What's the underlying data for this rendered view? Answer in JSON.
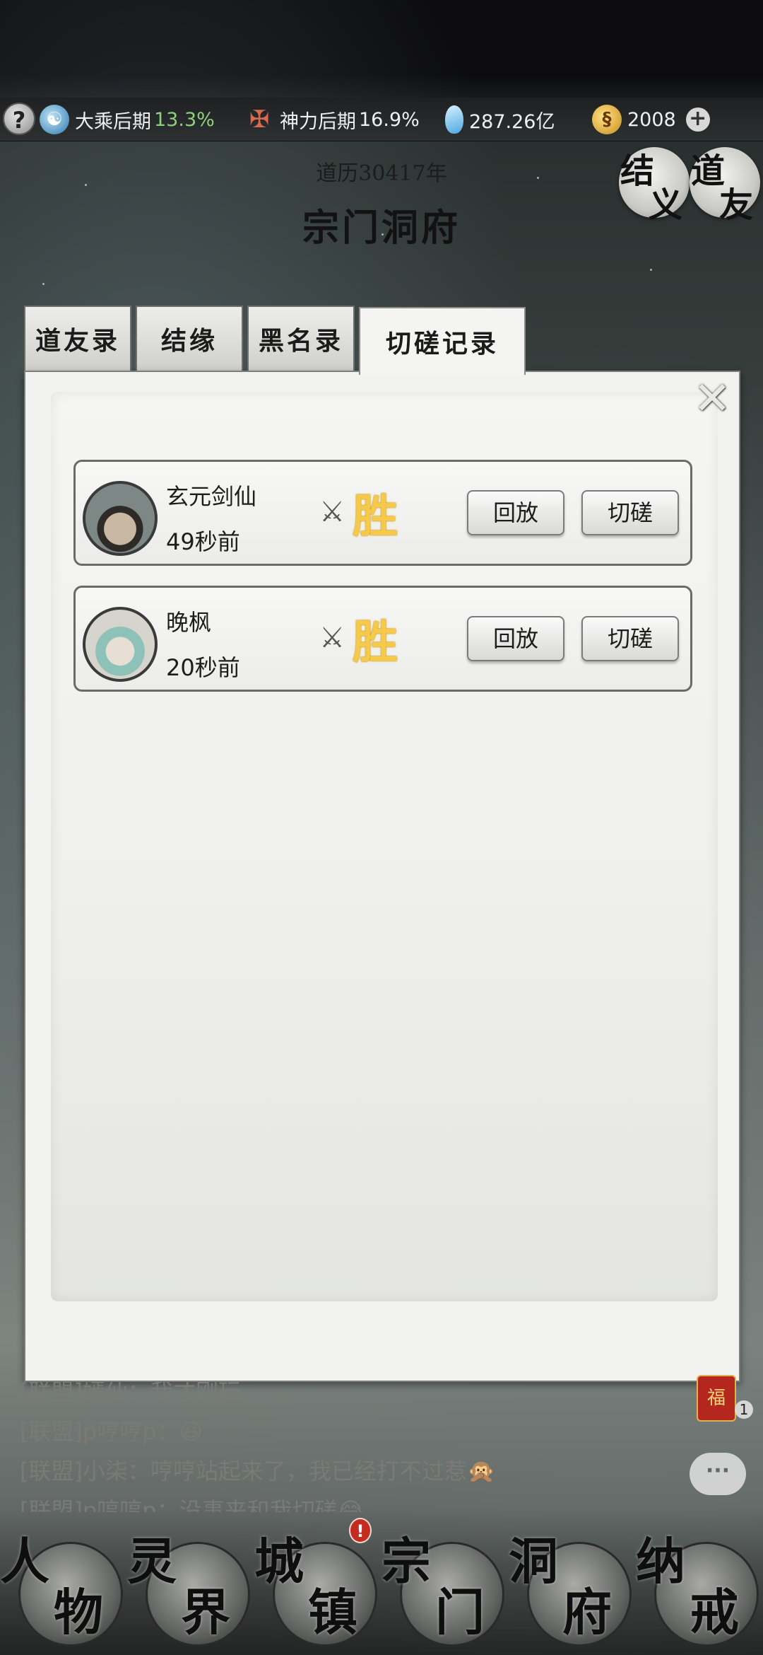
{
  "resources": {
    "cultivation_label": "大乘后期",
    "cultivation_pct": "13.3%",
    "divine_label": "神力后期",
    "divine_pct": "16.9%",
    "crystals": "287.26亿",
    "coins": "2008"
  },
  "header": {
    "year": "道历30417年",
    "title": "宗门洞府"
  },
  "top_buttons": [
    {
      "c1": "结",
      "c2": "义"
    },
    {
      "c1": "道",
      "c2": "友"
    }
  ],
  "tabs": [
    "道友录",
    "结缘",
    "黑名录",
    "切磋记录"
  ],
  "active_tab": "切磋记录",
  "records": [
    {
      "name": "玄元剑仙",
      "time": "49秒前",
      "result": "胜",
      "replay": "回放",
      "spar": "切磋"
    },
    {
      "name": "晚枫",
      "time": "20秒前",
      "result": "胜",
      "replay": "回放",
      "spar": "切磋"
    }
  ],
  "chat": [
    "[联盟]嫣仙：我才刚玩",
    "[联盟]p哼哼p：😃",
    "[联盟]小柒：哼哼站起来了，我已经打不过惹🙊",
    "[联盟]p哼哼p：没事来和我切磋😂"
  ],
  "side": {
    "fu_label": "福",
    "fu_count": "1"
  },
  "nav": [
    {
      "c1": "人",
      "c2": "物"
    },
    {
      "c1": "灵",
      "c2": "界"
    },
    {
      "c1": "城",
      "c2": "镇",
      "alert": "!"
    },
    {
      "c1": "宗",
      "c2": "门"
    },
    {
      "c1": "洞",
      "c2": "府"
    },
    {
      "c1": "纳",
      "c2": "戒"
    }
  ],
  "colors": {
    "win": "#f6c948",
    "pct_green": "#8fd17a",
    "panel_bg": "#f2f2f0"
  }
}
